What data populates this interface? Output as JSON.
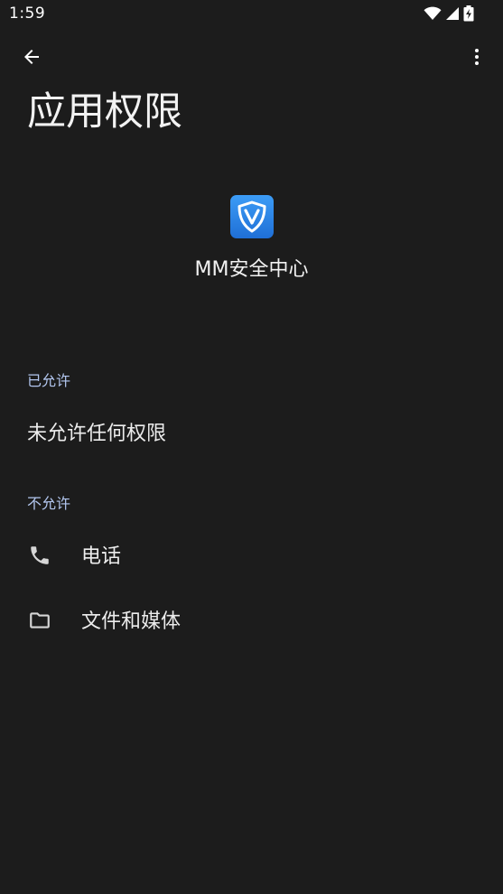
{
  "status_bar": {
    "time": "1:59",
    "icons": [
      "wifi-icon",
      "signal-icon",
      "battery-charging-icon"
    ]
  },
  "app_bar": {
    "back_icon": "arrow-back-icon",
    "more_icon": "more-vert-icon"
  },
  "page": {
    "title": "应用权限"
  },
  "app": {
    "name": "MM安全中心",
    "icon": "shield-v-icon",
    "icon_colors": [
      "#2f8ff0",
      "#1f6fd6"
    ]
  },
  "sections": {
    "allowed": {
      "header": "已允许",
      "empty_text": "未允许任何权限"
    },
    "denied": {
      "header": "不允许",
      "items": [
        {
          "label": "电话",
          "icon": "phone-icon"
        },
        {
          "label": "文件和媒体",
          "icon": "folder-icon"
        }
      ]
    }
  },
  "colors": {
    "background": "#1c1c1c",
    "section_header": "#b3c7f0",
    "text": "#ececec"
  }
}
